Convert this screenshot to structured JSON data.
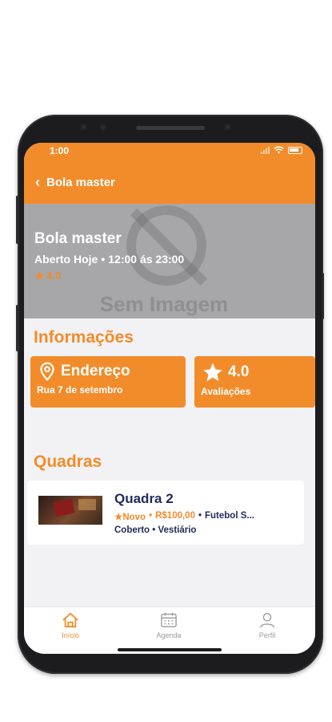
{
  "status_bar": {
    "time": "1:00"
  },
  "nav": {
    "back_label": "Bola master"
  },
  "hero": {
    "placeholder_text": "Sem Imagem",
    "title": "Bola master",
    "open_status": "Aberto Hoje",
    "hours": "12:00 ás 23:00",
    "rating": "4.0"
  },
  "info": {
    "section_title": "Informações",
    "address": {
      "title": "Endereço",
      "value": "Rua 7 de setembro"
    },
    "reviews": {
      "title": "4.0",
      "label": "Avaliações"
    }
  },
  "courts": {
    "section_title": "Quadras",
    "items": [
      {
        "name": "Quadra 2",
        "badge": "Novo",
        "price": "R$100,00",
        "sport": "Futebol S...",
        "tags": "Coberto • Vestiário"
      }
    ]
  },
  "tabs": [
    {
      "label": "Início",
      "active": true
    },
    {
      "label": "Agenda",
      "active": false
    },
    {
      "label": "Perfil",
      "active": false
    }
  ],
  "colors": {
    "accent": "#f28c2b",
    "navy": "#1f2a5a",
    "hero_bg": "#a7a7aa"
  }
}
